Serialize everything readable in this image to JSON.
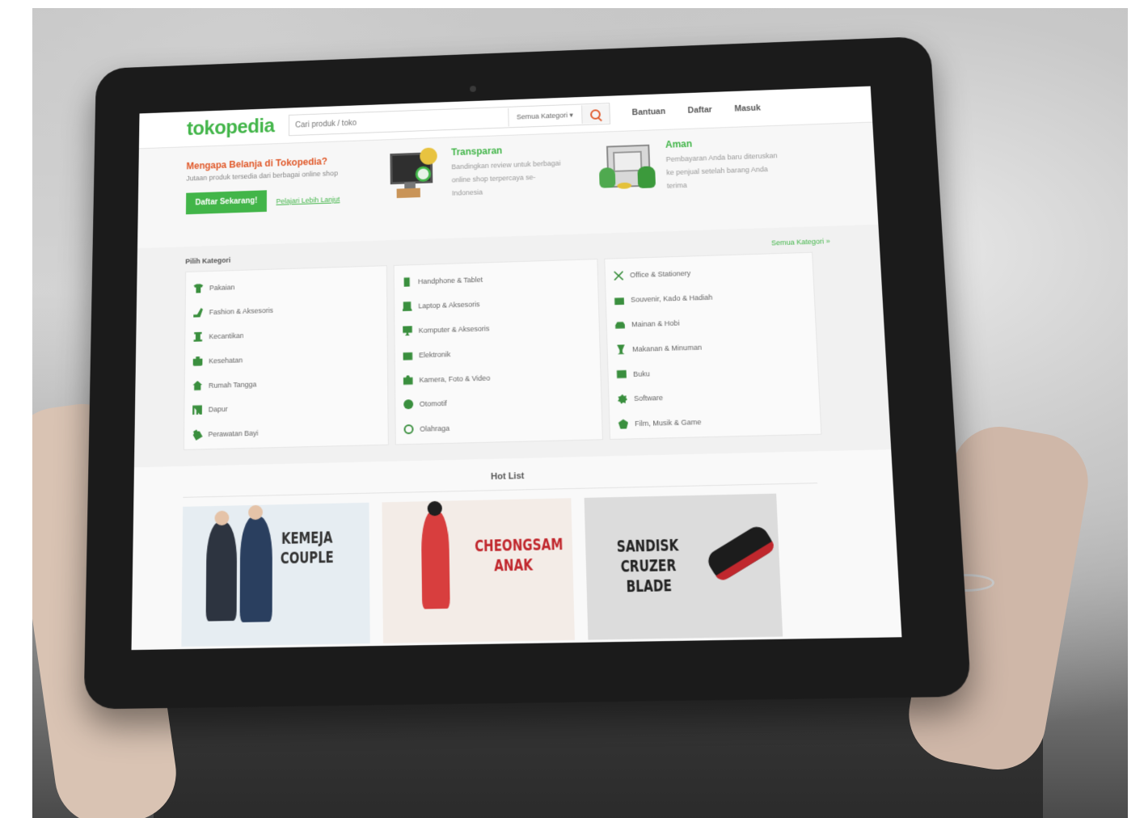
{
  "header": {
    "logo": "tokopedia",
    "search_placeholder": "Cari produk / toko",
    "category_select": "Semua Kategori",
    "nav": [
      "Bantuan",
      "Daftar",
      "Masuk"
    ]
  },
  "intro": {
    "title": "Mengapa Belanja di Tokopedia?",
    "subtitle": "Jutaan produk tersedia dari berbagai online shop",
    "cta_label": "Daftar Sekarang!",
    "learn_more": "Pelajari Lebih Lanjut",
    "features": [
      {
        "title": "Transparan",
        "desc": "Bandingkan review untuk berbagai online shop terpercaya se-Indonesia"
      },
      {
        "title": "Aman",
        "desc": "Pembayaran Anda baru diteruskan ke penjual setelah barang Anda terima"
      }
    ]
  },
  "categories": {
    "heading": "Pilih Kategori",
    "all_link": "Semua Kategori »",
    "columns": [
      [
        {
          "label": "Pakaian",
          "icon": "shirt-icon"
        },
        {
          "label": "Fashion & Aksesoris",
          "icon": "shoe-icon"
        },
        {
          "label": "Kecantikan",
          "icon": "beauty-icon"
        },
        {
          "label": "Kesehatan",
          "icon": "health-icon"
        },
        {
          "label": "Rumah Tangga",
          "icon": "house-icon"
        },
        {
          "label": "Dapur",
          "icon": "fork-icon"
        },
        {
          "label": "Perawatan Bayi",
          "icon": "baby-bottle-icon"
        }
      ],
      [
        {
          "label": "Handphone & Tablet",
          "icon": "phone-icon"
        },
        {
          "label": "Laptop & Aksesoris",
          "icon": "laptop-icon"
        },
        {
          "label": "Komputer & Aksesoris",
          "icon": "monitor-icon"
        },
        {
          "label": "Elektronik",
          "icon": "tv-icon"
        },
        {
          "label": "Kamera, Foto & Video",
          "icon": "camera-icon"
        },
        {
          "label": "Otomotif",
          "icon": "steering-icon"
        },
        {
          "label": "Olahraga",
          "icon": "ball-icon"
        }
      ],
      [
        {
          "label": "Office & Stationery",
          "icon": "scissors-icon"
        },
        {
          "label": "Souvenir, Kado & Hadiah",
          "icon": "gift-icon"
        },
        {
          "label": "Mainan & Hobi",
          "icon": "toy-car-icon"
        },
        {
          "label": "Makanan & Minuman",
          "icon": "cup-icon"
        },
        {
          "label": "Buku",
          "icon": "book-icon"
        },
        {
          "label": "Software",
          "icon": "software-icon"
        },
        {
          "label": "Film, Musik & Game",
          "icon": "film-icon"
        }
      ]
    ]
  },
  "hotlist": {
    "title": "Hot List",
    "cards": [
      {
        "title_line1": "KEMEJA",
        "title_line2": "COUPLE"
      },
      {
        "title_line1": "CHEONGSAM",
        "title_line2": "ANAK"
      },
      {
        "title_line1": "SANDISK",
        "title_line2": "CRUZER BLADE"
      }
    ]
  }
}
